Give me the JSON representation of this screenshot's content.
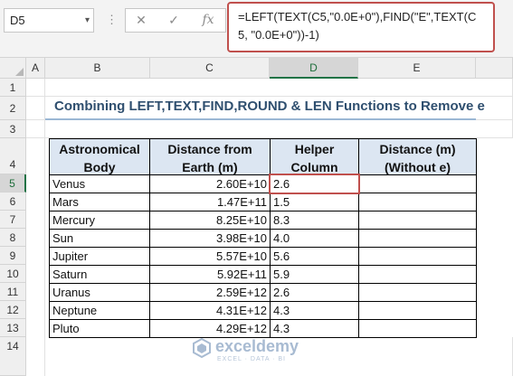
{
  "name_box": {
    "value": "D5"
  },
  "formula_bar": {
    "cancel_icon": "✕",
    "enter_icon": "✓",
    "fx_label": "fx",
    "formula": "=LEFT(TEXT(C5,\"0.0E+0\"),FIND(\"E\",TEXT(C5, \"0.0E+0\"))-1)"
  },
  "columns": [
    "A",
    "B",
    "C",
    "D",
    "E"
  ],
  "rows": [
    "1",
    "2",
    "3",
    "4",
    "5",
    "6",
    "7",
    "8",
    "9",
    "10",
    "11",
    "12",
    "13",
    "14"
  ],
  "selected_cell": "D5",
  "title": "Combining LEFT,TEXT,FIND,ROUND & LEN Functions to Remove e",
  "table": {
    "headers": [
      "Astronomical Body",
      "Distance from Earth (m)",
      "Helper Column",
      "Distance (m) (Without e)"
    ],
    "rows": [
      {
        "body": "Venus",
        "distance": "2.60E+10",
        "helper": "2.6",
        "result": ""
      },
      {
        "body": "Mars",
        "distance": "1.47E+11",
        "helper": "1.5",
        "result": ""
      },
      {
        "body": "Mercury",
        "distance": "8.25E+10",
        "helper": "8.3",
        "result": ""
      },
      {
        "body": "Sun",
        "distance": "3.98E+10",
        "helper": "4.0",
        "result": ""
      },
      {
        "body": "Jupiter",
        "distance": "5.57E+10",
        "helper": "5.6",
        "result": ""
      },
      {
        "body": "Saturn",
        "distance": "5.92E+11",
        "helper": "5.9",
        "result": ""
      },
      {
        "body": "Uranus",
        "distance": "2.59E+12",
        "helper": "2.6",
        "result": ""
      },
      {
        "body": "Neptune",
        "distance": "4.31E+12",
        "helper": "4.3",
        "result": ""
      },
      {
        "body": "Pluto",
        "distance": "4.29E+12",
        "helper": "4.3",
        "result": ""
      }
    ]
  },
  "watermark": {
    "name": "exceldemy",
    "tagline": "EXCEL · DATA · BI"
  },
  "colors": {
    "accent_red": "#c0504d",
    "header_fill": "#dce6f2",
    "excel_green": "#217346",
    "title_text": "#2f4f6f"
  }
}
